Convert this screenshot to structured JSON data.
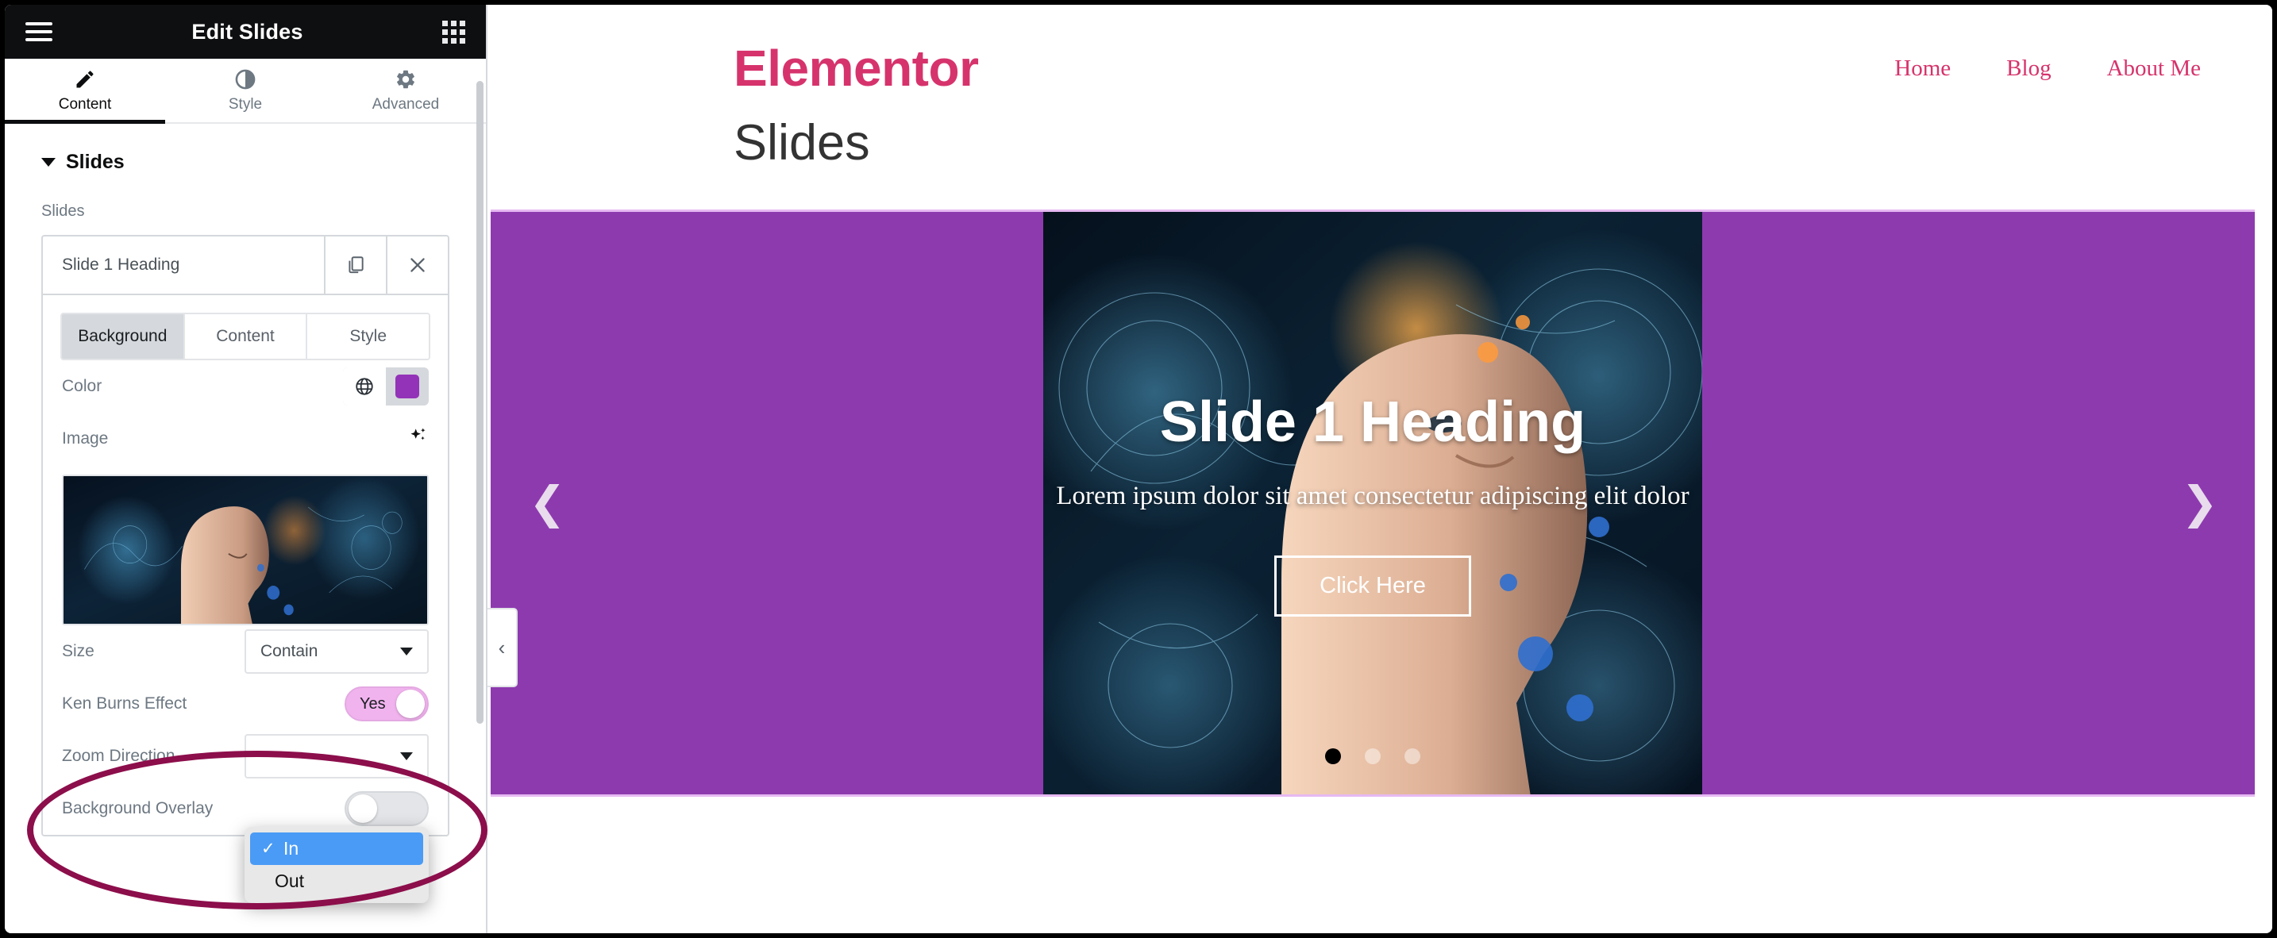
{
  "panel": {
    "title": "Edit Slides",
    "menu_icon": "hamburger-icon",
    "apps_icon": "grid-icon",
    "tabs": [
      {
        "label": "Content",
        "icon": "pencil-icon",
        "active": true
      },
      {
        "label": "Style",
        "icon": "contrast-icon",
        "active": false
      },
      {
        "label": "Advanced",
        "icon": "gear-icon",
        "active": false
      }
    ],
    "section": {
      "title": "Slides"
    },
    "slides_field_label": "Slides",
    "repeater": {
      "item_title": "Slide 1 Heading",
      "duplicate_icon": "copy-icon",
      "remove_icon": "close-icon"
    },
    "subtabs": [
      {
        "label": "Background",
        "active": true
      },
      {
        "label": "Content",
        "active": false
      },
      {
        "label": "Style",
        "active": false
      }
    ],
    "controls": {
      "color_label": "Color",
      "color_globe_icon": "globe-icon",
      "color_value": "#9333b8",
      "image_label": "Image",
      "image_ai_icon": "sparkle-icon",
      "size_label": "Size",
      "size_value": "Contain",
      "ken_burns_label": "Ken Burns Effect",
      "ken_burns_value": "Yes",
      "zoom_direction_label": "Zoom Direction",
      "background_overlay_label": "Background Overlay"
    },
    "dropdown": {
      "open": true,
      "check_glyph": "✓",
      "options": [
        {
          "label": "In",
          "selected": true
        },
        {
          "label": "Out",
          "selected": false
        }
      ]
    },
    "annotation_color": "#8c0e4b"
  },
  "canvas": {
    "brand": "Elementor",
    "brand_color": "#d6336c",
    "nav": [
      {
        "label": "Home"
      },
      {
        "label": "Blog"
      },
      {
        "label": "About Me"
      }
    ],
    "page_title": "Slides",
    "slider": {
      "background_color": "#8e3aaf",
      "heading": "Slide 1 Heading",
      "description": "Lorem ipsum dolor sit amet consectetur adipiscing elit dolor",
      "button_label": "Click Here",
      "prev_icon": "chevron-left-icon",
      "prev_glyph": "❮",
      "next_icon": "chevron-right-icon",
      "next_glyph": "❯",
      "dots": [
        {
          "active": true
        },
        {
          "active": false
        },
        {
          "active": false
        }
      ]
    },
    "collapse_handle_glyph": "‹"
  }
}
